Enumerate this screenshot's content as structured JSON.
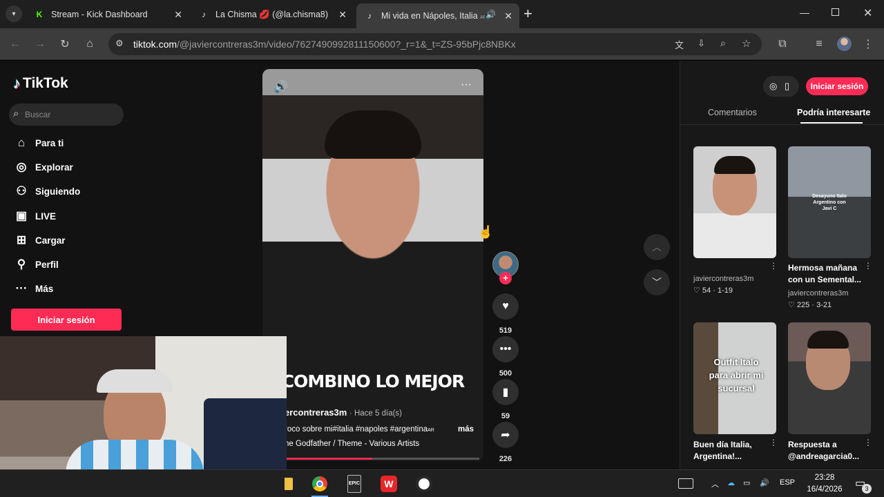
{
  "tabs": [
    {
      "title": "Stream - Kick Dashboard",
      "favicon": "kick-icon",
      "close": "✕"
    },
    {
      "title": "La Chisma 💋 (@la.chisma8) | T",
      "favicon": "tiktok-icon",
      "close": "✕"
    },
    {
      "title": "Mi vida en Nápoles, Italia",
      "suffix": "AR",
      "favicon": "tiktok-icon",
      "close": "✕"
    }
  ],
  "new_tab": "+",
  "address_bar": {
    "domain": "tiktok.com",
    "path": "/@javiercontreras3m/video/7627490992811150600?_r=1&_t=ZS-95bPjc8NBKx"
  },
  "sidebar": {
    "logo": "TikTok",
    "search_placeholder": "Buscar",
    "nav": [
      {
        "label": "Para ti",
        "icon": "home-icon"
      },
      {
        "label": "Explorar",
        "icon": "compass-icon"
      },
      {
        "label": "Siguiendo",
        "icon": "following-icon"
      },
      {
        "label": "LIVE",
        "icon": "live-icon"
      },
      {
        "label": "Cargar",
        "icon": "upload-icon"
      },
      {
        "label": "Perfil",
        "icon": "profile-icon"
      },
      {
        "label": "Más",
        "icon": "more-icon"
      }
    ],
    "login_button": "Iniciar sesión"
  },
  "video": {
    "overlay_text": "COMBINO LO MEJOR",
    "author": "ercontreras3m",
    "time_ago": "· Hace 5 día(s)",
    "description": "roco sobre mi#italia #napoles #argentina",
    "description_suffix": "AR",
    "more": "más",
    "music": "he Godfather / Theme - Various Artists",
    "likes": "519",
    "comments": "500",
    "saves": "59",
    "shares": "226"
  },
  "right_panel": {
    "login_button": "Iniciar sesión",
    "tabs": [
      "Comentarios",
      "Podría interesarte"
    ],
    "active_tab": 1,
    "videos": [
      {
        "title": "",
        "author": "javiercontreras3m",
        "likes": "54",
        "date": "1-19",
        "overlay": ""
      },
      {
        "title": "Hermosa mañana con un Semental...",
        "author": "javiercontreras3m",
        "likes": "225",
        "date": "3-21",
        "overlay": "Desayuno Italo Argentino con Javi C"
      },
      {
        "title": "Buen día Italia, Argentina!...",
        "author": "",
        "likes": "",
        "date": "",
        "overlay": "Outfit Italo para abrir mi sucursal"
      },
      {
        "title": "Respuesta a @andreagarcia0...",
        "author": "",
        "likes": "",
        "date": "",
        "overlay": ""
      }
    ]
  },
  "taskbar": {
    "lang": "ESP",
    "time": "23:28",
    "date": "16/4/2026",
    "notifications": "3",
    "apps": [
      "folder-icon",
      "chrome-icon",
      "epic-games-icon",
      "wps-icon",
      "obs-icon"
    ],
    "epic_label": "EPIC"
  },
  "colors": {
    "accent": "#fe2c55",
    "background": "#121212",
    "chrome_dark": "#1f1f1f"
  }
}
